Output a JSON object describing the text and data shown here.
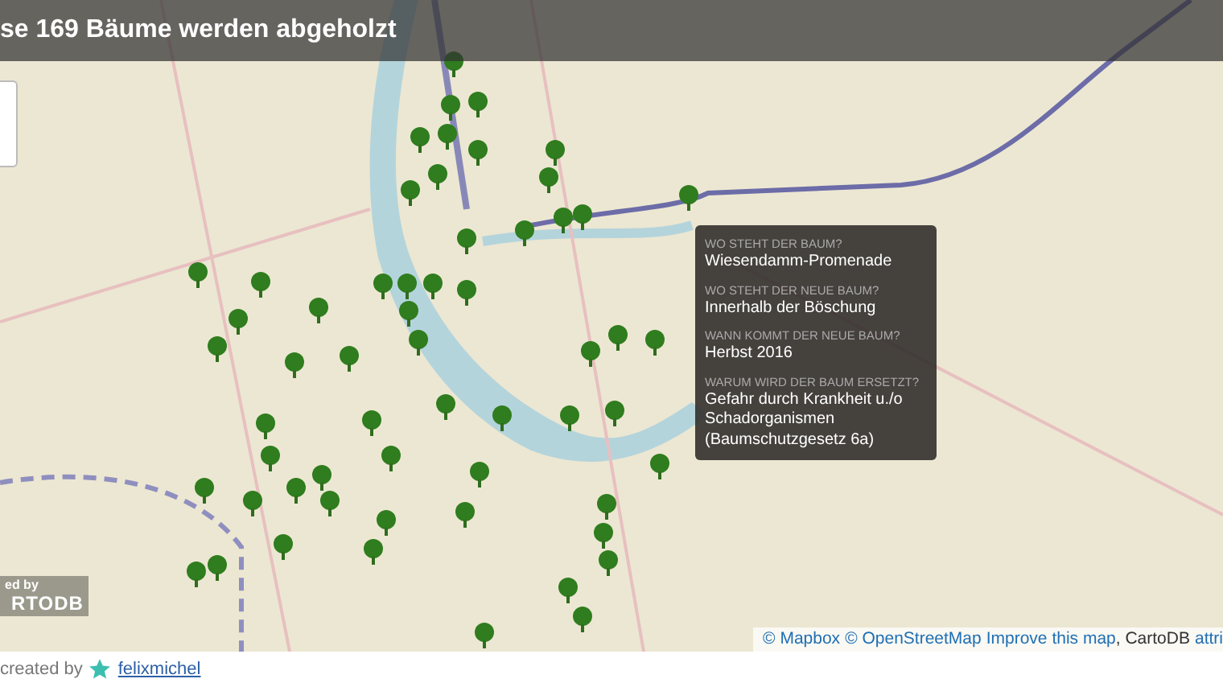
{
  "header": {
    "title": "se 169 Bäume werden abgeholzt"
  },
  "map": {
    "logo_caption": "ed by",
    "logo": "RTODB"
  },
  "tooltip": {
    "fields": [
      {
        "label": "WO STEHT DER BAUM?",
        "value": "Wiesendamm-Promenade"
      },
      {
        "label": "WO STEHT DER NEUE BAUM?",
        "value": "Innerhalb der Böschung"
      },
      {
        "label": "WANN KOMMT DER NEUE BAUM?",
        "value": "Herbst 2016"
      },
      {
        "label": "WARUM WIRD DER BAUM ERSETZT?",
        "value": "Gefahr durch Krankheit u./o Schadorganismen (Baumschutzgesetz 6a)"
      }
    ]
  },
  "attribution": [
    {
      "kind": "link",
      "text": "© Mapbox"
    },
    {
      "kind": "link",
      "text": "© OpenStreetMap"
    },
    {
      "kind": "link",
      "text": "Improve this map"
    },
    {
      "kind": "text",
      "text": ", CartoDB"
    },
    {
      "kind": "link",
      "text": "attri"
    }
  ],
  "footer": {
    "label": "created by",
    "author": "felixmichel"
  }
}
